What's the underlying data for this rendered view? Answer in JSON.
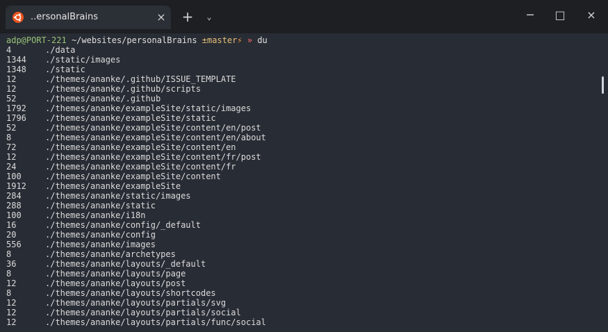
{
  "tab": {
    "title": "..ersonalBrains",
    "close": "×"
  },
  "titlebar": {
    "new_tab": "+",
    "dropdown": "⌄",
    "minimize": "─",
    "maximize": "□",
    "close": "×"
  },
  "prompt": {
    "user": "adp@PORT-221",
    "path": "~/websites/personalBrains",
    "branch": "±master",
    "bolt": "⚡",
    "arrow": "»",
    "command": "du"
  },
  "output": [
    {
      "size": "4",
      "path": "./data"
    },
    {
      "size": "1344",
      "path": "./static/images"
    },
    {
      "size": "1348",
      "path": "./static"
    },
    {
      "size": "12",
      "path": "./themes/ananke/.github/ISSUE_TEMPLATE"
    },
    {
      "size": "12",
      "path": "./themes/ananke/.github/scripts"
    },
    {
      "size": "52",
      "path": "./themes/ananke/.github"
    },
    {
      "size": "1792",
      "path": "./themes/ananke/exampleSite/static/images"
    },
    {
      "size": "1796",
      "path": "./themes/ananke/exampleSite/static"
    },
    {
      "size": "52",
      "path": "./themes/ananke/exampleSite/content/en/post"
    },
    {
      "size": "8",
      "path": "./themes/ananke/exampleSite/content/en/about"
    },
    {
      "size": "72",
      "path": "./themes/ananke/exampleSite/content/en"
    },
    {
      "size": "12",
      "path": "./themes/ananke/exampleSite/content/fr/post"
    },
    {
      "size": "24",
      "path": "./themes/ananke/exampleSite/content/fr"
    },
    {
      "size": "100",
      "path": "./themes/ananke/exampleSite/content"
    },
    {
      "size": "1912",
      "path": "./themes/ananke/exampleSite"
    },
    {
      "size": "284",
      "path": "./themes/ananke/static/images"
    },
    {
      "size": "288",
      "path": "./themes/ananke/static"
    },
    {
      "size": "100",
      "path": "./themes/ananke/i18n"
    },
    {
      "size": "16",
      "path": "./themes/ananke/config/_default"
    },
    {
      "size": "20",
      "path": "./themes/ananke/config"
    },
    {
      "size": "556",
      "path": "./themes/ananke/images"
    },
    {
      "size": "8",
      "path": "./themes/ananke/archetypes"
    },
    {
      "size": "36",
      "path": "./themes/ananke/layouts/_default"
    },
    {
      "size": "8",
      "path": "./themes/ananke/layouts/page"
    },
    {
      "size": "12",
      "path": "./themes/ananke/layouts/post"
    },
    {
      "size": "8",
      "path": "./themes/ananke/layouts/shortcodes"
    },
    {
      "size": "12",
      "path": "./themes/ananke/layouts/partials/svg"
    },
    {
      "size": "12",
      "path": "./themes/ananke/layouts/partials/social"
    },
    {
      "size": "12",
      "path": "./themes/ananke/layouts/partials/func/social"
    }
  ]
}
